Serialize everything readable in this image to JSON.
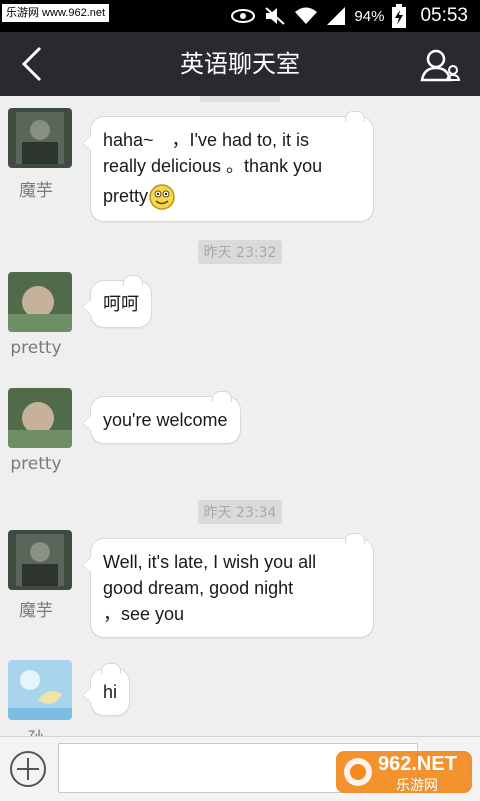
{
  "status_bar": {
    "watermark": "乐游网 www.962.net",
    "battery": "94%",
    "time": "05:53"
  },
  "header": {
    "title": "英语聊天室"
  },
  "chat": {
    "timestamps": [
      "昨天 23:32",
      "昨天 23:34"
    ],
    "messages": [
      {
        "sender": "魔芋",
        "lines": [
          "haha~　，I've had to, it is",
          "really delicious 。thank you",
          "pretty"
        ],
        "emoji": "smiley"
      },
      {
        "sender": "pretty",
        "lines": [
          "呵呵"
        ]
      },
      {
        "sender": "pretty",
        "lines": [
          "you're welcome"
        ]
      },
      {
        "sender": "魔芋",
        "lines": [
          "Well, it's late, I wish you all",
          "good dream, good night",
          "，see you"
        ]
      },
      {
        "sender": "孙",
        "lines": [
          "hi"
        ]
      }
    ]
  },
  "input_bar": {
    "value": "",
    "brand": "962.NET",
    "brand_sub": "乐游网"
  },
  "colors": {
    "status_bg": "#000000",
    "header_bg": "#2a2a2e",
    "chat_bg": "#efefef",
    "brand_orange": "#f28a1e"
  }
}
